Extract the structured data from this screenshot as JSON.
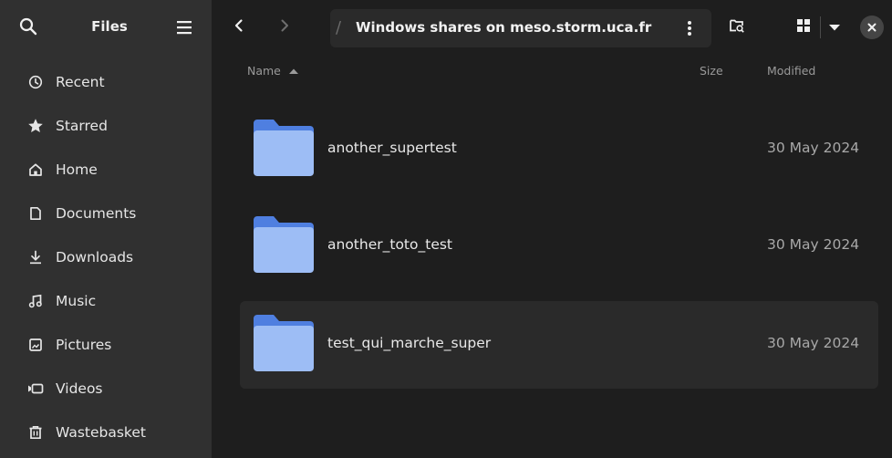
{
  "sidebar": {
    "title": "Files",
    "items": [
      {
        "label": "Recent",
        "icon": "clock-icon"
      },
      {
        "label": "Starred",
        "icon": "star-icon"
      },
      {
        "label": "Home",
        "icon": "home-icon"
      },
      {
        "label": "Documents",
        "icon": "document-icon"
      },
      {
        "label": "Downloads",
        "icon": "download-icon"
      },
      {
        "label": "Music",
        "icon": "music-icon"
      },
      {
        "label": "Pictures",
        "icon": "picture-icon"
      },
      {
        "label": "Videos",
        "icon": "video-icon"
      },
      {
        "label": "Wastebasket",
        "icon": "trash-icon"
      }
    ]
  },
  "header": {
    "path_separator": "/",
    "location": "Windows shares on meso.storm.uca.fr"
  },
  "columns": {
    "name": "Name",
    "size": "Size",
    "modified": "Modified"
  },
  "files": [
    {
      "name": "another_supertest",
      "size": "",
      "modified": "30 May 2024"
    },
    {
      "name": "another_toto_test",
      "size": "",
      "modified": "30 May 2024"
    },
    {
      "name": "test_qui_marche_super",
      "size": "",
      "modified": "30 May 2024"
    }
  ],
  "colors": {
    "sidebar_bg": "#303030",
    "main_bg": "#1e1e1e",
    "folder_back": "#4f7fe0",
    "folder_front": "#9dbdf5"
  }
}
